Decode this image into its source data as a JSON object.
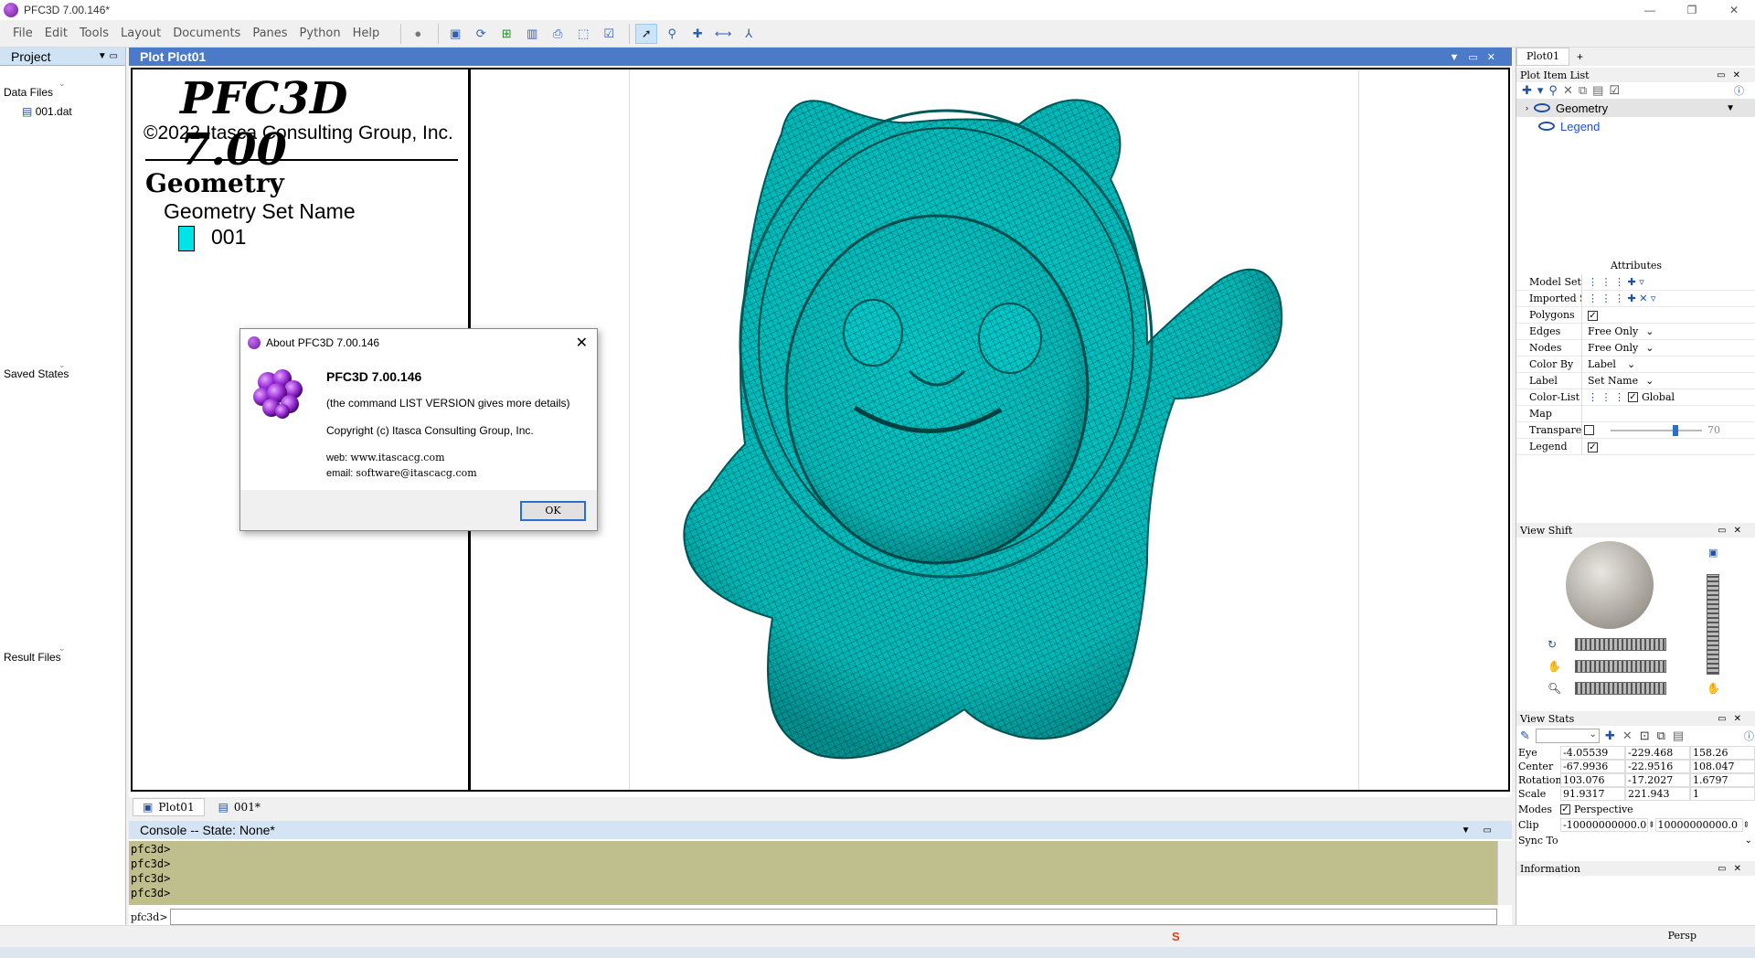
{
  "window": {
    "title": "PFC3D 7.00.146*"
  },
  "menu": {
    "items": [
      "File",
      "Edit",
      "Tools",
      "Layout",
      "Documents",
      "Panes",
      "Python",
      "Help"
    ]
  },
  "left_panel": {
    "title": "Project",
    "sections": {
      "data_files": "Data Files",
      "data_file_item": "001.dat",
      "saved_states": "Saved States",
      "result_files": "Result Files"
    }
  },
  "plot": {
    "title": "Plot Plot01",
    "legend": {
      "product": "PFC3D 7.00",
      "copyright": "©2022 Itasca Consulting Group, Inc.",
      "heading": "Geometry",
      "set_label": "Geometry Set Name",
      "set_value": "001",
      "set_color": "#00e4e8"
    },
    "model_color": "#00c8c8"
  },
  "doc_tabs": [
    "Plot01",
    "001*"
  ],
  "console": {
    "title": "Console -- State: None*",
    "lines": [
      "pfc3d>",
      "pfc3d>",
      "pfc3d>",
      "pfc3d>"
    ],
    "prompt": "pfc3d>"
  },
  "right_panel": {
    "tab": "Plot01",
    "tab_add": "+",
    "plot_item_list": {
      "title": "Plot Item List",
      "items": [
        "Geometry",
        "Legend"
      ]
    },
    "attributes": {
      "title": "Attributes",
      "rows": [
        {
          "k": "Model Sets",
          "v": ""
        },
        {
          "k": "Imported Sets",
          "v": ""
        },
        {
          "k": "Polygons",
          "v": "✓"
        },
        {
          "k": "Edges",
          "v": "Free Only"
        },
        {
          "k": "Nodes",
          "v": "Free Only"
        },
        {
          "k": "Color By",
          "v": "Label"
        },
        {
          "k": "Label",
          "v": "Set Name"
        },
        {
          "k": "Color-List",
          "v": "Global"
        },
        {
          "k": "Map",
          "v": ""
        },
        {
          "k": "Transparency",
          "v": "70"
        },
        {
          "k": "Legend",
          "v": "✓"
        }
      ]
    },
    "view_shift": {
      "title": "View Shift"
    },
    "view_stats": {
      "title": "View Stats",
      "rows": [
        {
          "k": "Eye",
          "c": [
            "-4.05539",
            "-229.468",
            "158.26"
          ]
        },
        {
          "k": "Center",
          "c": [
            "-67.9936",
            "-22.9516",
            "108.047"
          ]
        },
        {
          "k": "Rotation",
          "c": [
            "103.076",
            "-17.2027",
            "1.6797"
          ]
        },
        {
          "k": "Scale",
          "c": [
            "91.9317",
            "221.943",
            "1"
          ]
        }
      ],
      "modes": "Perspective",
      "clip": [
        "-10000000000.0",
        "10000000000.0"
      ],
      "sync": "Sync To"
    },
    "information": {
      "title": "Information"
    }
  },
  "status": {
    "mode": "Persp"
  },
  "dialog": {
    "title": "About PFC3D 7.00.146",
    "heading": "PFC3D 7.00.146",
    "note": "(the command LIST VERSION gives more details)",
    "copyright": "Copyright (c) Itasca Consulting Group, Inc.",
    "web_label": "web:",
    "web": "www.itascacg.com",
    "email_label": "email:",
    "email": "software@itascacg.com",
    "ok": "OK"
  }
}
